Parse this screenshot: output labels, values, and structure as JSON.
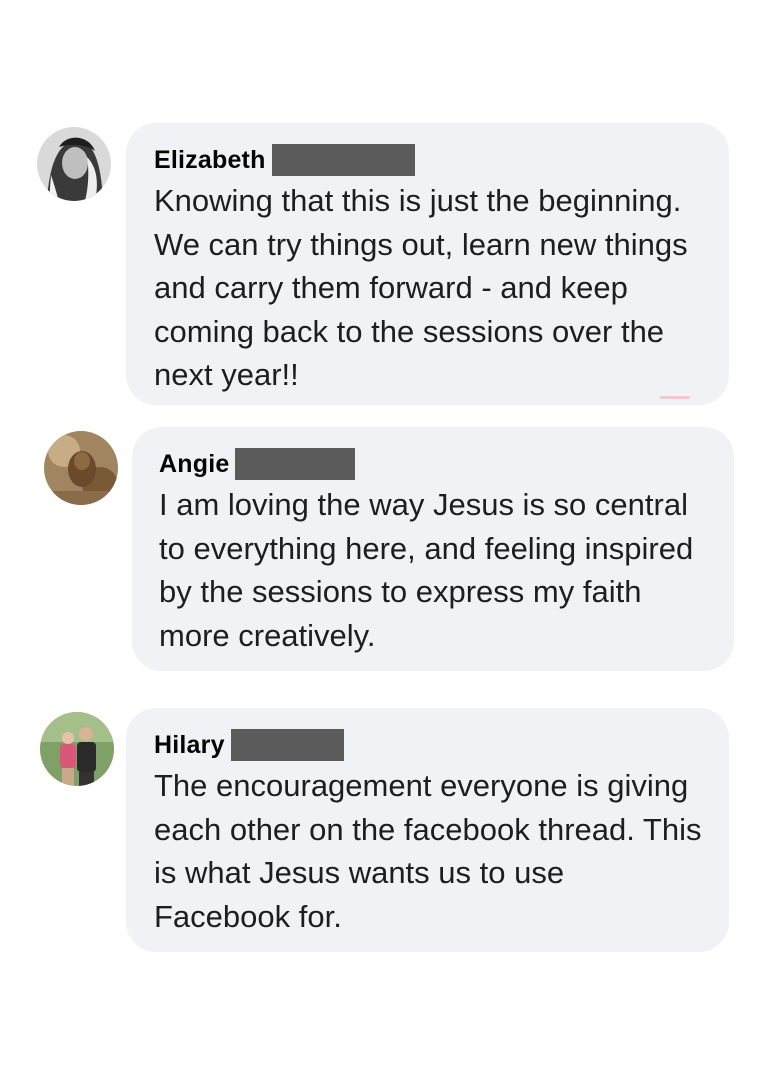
{
  "comments": [
    {
      "author": "Elizabeth",
      "text": "Knowing that this is just the beginning. We can try things out, learn new things and carry them forward - and keep coming back to the sessions over the next year!!",
      "avatar": "elizabeth-avatar"
    },
    {
      "author": "Angie",
      "text": "I am loving the way Jesus is so central to everything here, and feeling inspired by the sessions to express my faith more creatively.",
      "avatar": "angie-avatar"
    },
    {
      "author": "Hilary",
      "text": "The encouragement everyone is giving each other on the facebook thread. This is what Jesus wants us to use Facebook for.",
      "avatar": "hilary-avatar"
    }
  ],
  "colors": {
    "bubble": "#f0f2f5",
    "redaction": "#5b5b5b",
    "text": "#1c1e21"
  }
}
